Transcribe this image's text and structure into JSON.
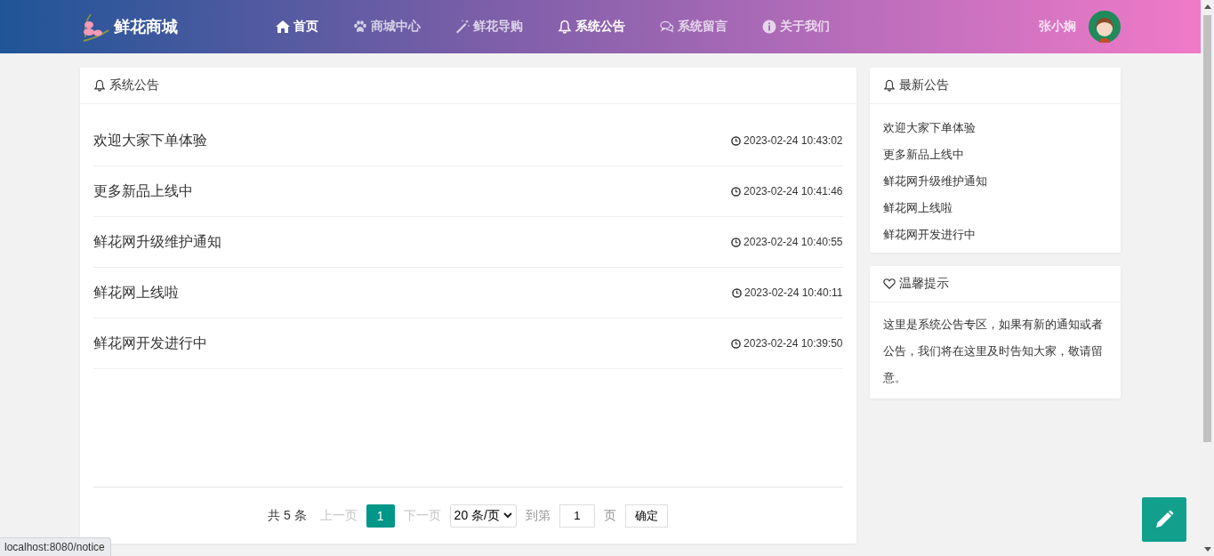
{
  "header": {
    "brand": "鲜花商城",
    "nav": [
      {
        "label": "首页",
        "kind": "home",
        "selected": true
      },
      {
        "label": "商城中心",
        "kind": "paw",
        "selected": false
      },
      {
        "label": "鲜花导购",
        "kind": "wand",
        "selected": false
      },
      {
        "label": "系统公告",
        "kind": "bell",
        "selected": true
      },
      {
        "label": "系统留言",
        "kind": "comments",
        "selected": false
      },
      {
        "label": "关于我们",
        "kind": "info",
        "selected": false
      }
    ],
    "user": "张小娴"
  },
  "notices": {
    "title": "系统公告",
    "items": [
      {
        "title": "欢迎大家下单体验",
        "time": "2023-02-24 10:43:02"
      },
      {
        "title": "更多新品上线中",
        "time": "2023-02-24 10:41:46"
      },
      {
        "title": "鲜花网升级维护通知",
        "time": "2023-02-24 10:40:55"
      },
      {
        "title": "鲜花网上线啦",
        "time": "2023-02-24 10:40:11"
      },
      {
        "title": "鲜花网开发进行中",
        "time": "2023-02-24 10:39:50"
      }
    ]
  },
  "pagination": {
    "total": "共 5 条",
    "prev": {
      "label": "上一页",
      "disabled": true
    },
    "pages": [
      {
        "label": "1",
        "selected": true
      }
    ],
    "next": {
      "label": "下一页",
      "disabled": true
    },
    "page_size": "20 条/页",
    "goto": "到第",
    "goto_value": "1",
    "page_unit": "页",
    "confirm": "确定"
  },
  "latest": {
    "title": "最新公告",
    "items": [
      "欢迎大家下单体验",
      "更多新品上线中",
      "鲜花网升级维护通知",
      "鲜花网上线啦",
      "鲜花网开发进行中"
    ]
  },
  "tips": {
    "title": "温馨提示",
    "text": "这里是系统公告专区，如果有新的通知或者公告，我们将在这里及时告知大家，敬请留意。"
  },
  "status_url": "localhost:8080/notice"
}
